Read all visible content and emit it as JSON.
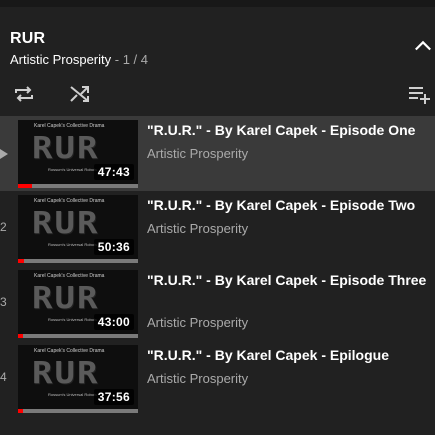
{
  "playlist": {
    "title": "RUR",
    "channel": "Artistic Prosperity",
    "separator": " - ",
    "position": "1 / 4"
  },
  "controls": {
    "collapse_icon": "chevron-up-icon",
    "loop_icon": "loop-icon",
    "shuffle_icon": "shuffle-icon",
    "save_icon": "playlist-add-icon"
  },
  "thumbnail": {
    "caption_top": "Karel Capek's Collective Drama",
    "logo_text": "RUR",
    "caption_bottom": "Rossum's Universal Robots"
  },
  "colors": {
    "background": "#212121",
    "active_row": "#3a3a3a",
    "muted_text": "#aaaaaa",
    "progress_red": "#ff0000"
  },
  "items": [
    {
      "index": "",
      "playing": true,
      "title": "\"R.U.R.\" - By Karel Capek - Episode One",
      "channel": "Artistic Prosperity",
      "duration": "47:43",
      "watched": 0.12
    },
    {
      "index": "2",
      "playing": false,
      "title": "\"R.U.R.\" - By Karel Capek - Episode Two",
      "channel": "Artistic Prosperity",
      "duration": "50:36",
      "watched": 0.05
    },
    {
      "index": "3",
      "playing": false,
      "title": "\"R.U.R.\" - By Karel Capek - Episode Three",
      "channel": "Artistic Prosperity",
      "duration": "43:00",
      "watched": 0.04
    },
    {
      "index": "4",
      "playing": false,
      "title": "\"R.U.R.\" - By Karel Capek - Epilogue",
      "channel": "Artistic Prosperity",
      "duration": "37:56",
      "watched": 0.04
    }
  ]
}
